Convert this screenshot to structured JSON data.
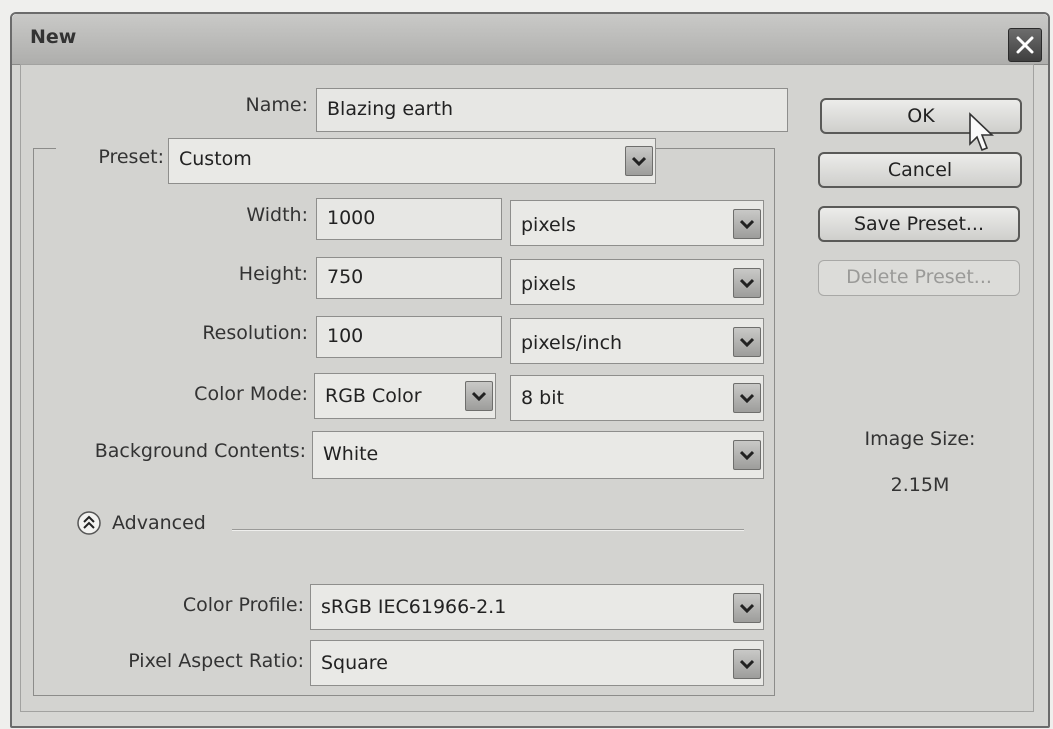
{
  "dialog": {
    "title": "New",
    "close_icon": "close-icon"
  },
  "form": {
    "name_label": "Name:",
    "name_value": "Blazing earth",
    "preset_label": "Preset:",
    "preset_value": "Custom",
    "width_label": "Width:",
    "width_value": "1000",
    "width_unit": "pixels",
    "height_label": "Height:",
    "height_value": "750",
    "height_unit": "pixels",
    "resolution_label": "Resolution:",
    "resolution_value": "100",
    "resolution_unit": "pixels/inch",
    "color_mode_label": "Color Mode:",
    "color_mode_value": "RGB Color",
    "bit_depth_value": "8 bit",
    "background_label": "Background Contents:",
    "background_value": "White",
    "advanced_label": "Advanced",
    "color_profile_label": "Color Profile:",
    "color_profile_value": "sRGB IEC61966-2.1",
    "pixel_aspect_label": "Pixel Aspect Ratio:",
    "pixel_aspect_value": "Square"
  },
  "buttons": {
    "ok": "OK",
    "cancel": "Cancel",
    "save_preset": "Save Preset...",
    "delete_preset": "Delete Preset..."
  },
  "info": {
    "image_size_label": "Image Size:",
    "image_size_value": "2.15M"
  }
}
